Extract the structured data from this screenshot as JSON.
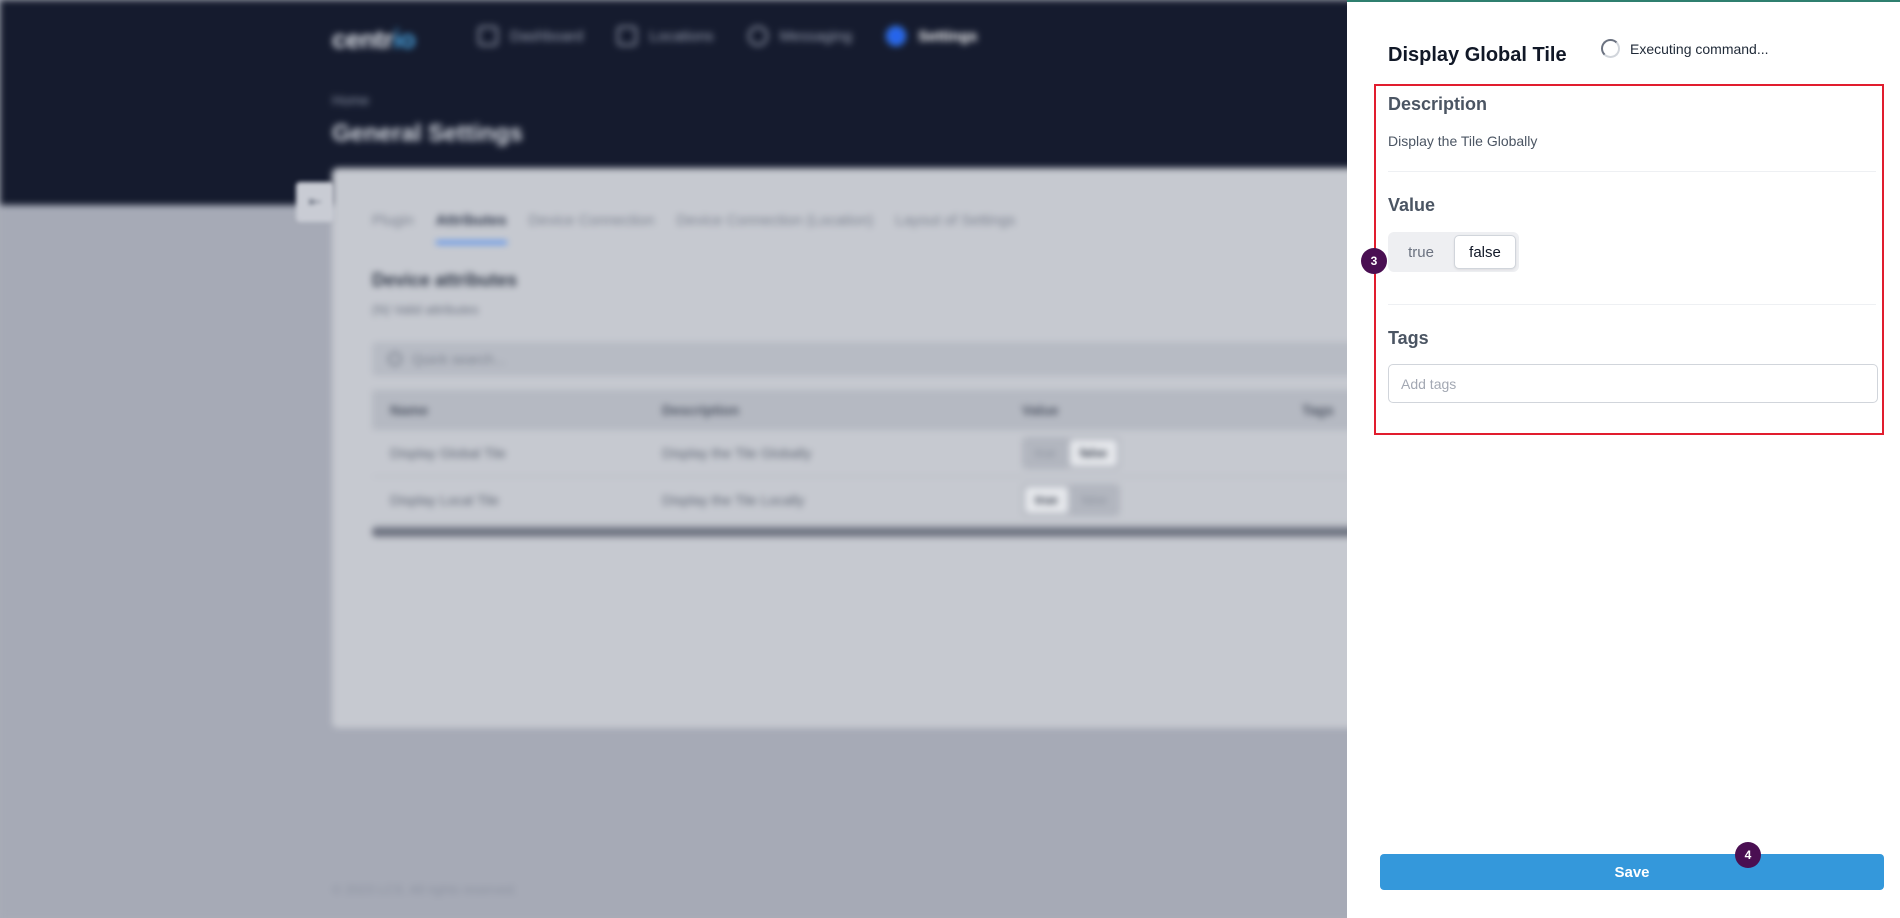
{
  "app": {
    "logo_text": "centr",
    "logo_accent": "io",
    "nav": [
      {
        "label": "Dashboard",
        "icon": "dashboard-icon"
      },
      {
        "label": "Locations",
        "icon": "locations-icon"
      },
      {
        "label": "Messaging",
        "icon": "messaging-icon"
      },
      {
        "label": "Settings",
        "icon": "settings-icon",
        "active": true
      }
    ],
    "breadcrumb": "Home",
    "page_title": "General Settings",
    "tabs": [
      "Plugin",
      "Attributes",
      "Device Connection",
      "Device Connection (Location)",
      "Layout of Settings"
    ],
    "active_tab": "Attributes",
    "section_title": "Device attributes",
    "section_subtitle": "(N) Valid attributes",
    "search_placeholder": "Quick search...",
    "table": {
      "headers": [
        "Name",
        "Description",
        "Value",
        "Tags"
      ],
      "rows": [
        {
          "name": "Display Global Tile",
          "description": "Display the Tile Globally",
          "true_label": "true",
          "false_label": "false",
          "value": "false"
        },
        {
          "name": "Display Local Tile",
          "description": "Display the Tile Locally",
          "true_label": "true",
          "false_label": "false",
          "value": "true"
        }
      ]
    },
    "footer": "© 2023 LCS. All rights reserved."
  },
  "drawer": {
    "title": "Display Global Tile",
    "status_text": "Executing command...",
    "description_label": "Description",
    "description_text": "Display the Tile Globally",
    "value_label": "Value",
    "value_options": [
      "true",
      "false"
    ],
    "value_selected": "false",
    "tags_label": "Tags",
    "tags_placeholder": "Add tags",
    "save_label": "Save"
  },
  "annotations": {
    "badge_value": "3",
    "badge_save": "4",
    "highlight_color": "#e11d2e",
    "badge_color": "#4a0f52"
  },
  "colors": {
    "header_bg": "#151b2e",
    "accent": "#3498db"
  }
}
